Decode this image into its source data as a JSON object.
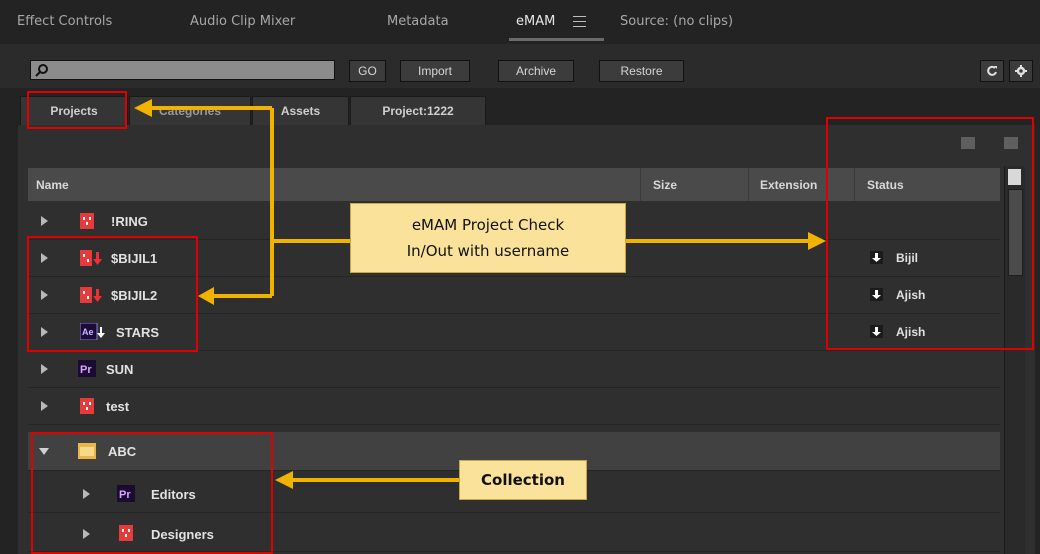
{
  "panel_tabs": [
    {
      "label": "Effect Controls",
      "active": false
    },
    {
      "label": "Audio Clip Mixer",
      "active": false
    },
    {
      "label": "Metadata",
      "active": false
    },
    {
      "label": "eMAM",
      "active": true
    },
    {
      "label": "Source: (no clips)",
      "active": false
    }
  ],
  "toolbar": {
    "search_value": "",
    "go_label": "GO",
    "import_label": "Import",
    "archive_label": "Archive",
    "restore_label": "Restore",
    "refresh_icon": "refresh-icon",
    "settings_icon": "gear-icon"
  },
  "sub_tabs": [
    "Projects",
    "Categories",
    "Assets",
    "Project:1222"
  ],
  "table": {
    "columns": [
      "Name",
      "Size",
      "Extension",
      "Status"
    ],
    "rows": [
      {
        "name": "!RING",
        "icon": "project-icon",
        "status": "",
        "expanded": false
      },
      {
        "name": "$BIJIL1",
        "icon": "project-checkout-icon",
        "status": "Bijil",
        "expanded": false
      },
      {
        "name": "$BIJIL2",
        "icon": "project-checkout-icon",
        "status": "Ajish",
        "expanded": false
      },
      {
        "name": "STARS",
        "icon": "after-effects-checkout-icon",
        "status": "Ajish",
        "expanded": false
      },
      {
        "name": "SUN",
        "icon": "premiere-icon",
        "status": "",
        "expanded": false
      },
      {
        "name": "test",
        "icon": "project-icon",
        "status": "",
        "expanded": false
      },
      {
        "name": "ABC",
        "icon": "collection-folder-icon",
        "status": "",
        "expanded": true
      },
      {
        "name": "Editors",
        "icon": "premiere-icon",
        "status": "",
        "child": true
      },
      {
        "name": "Designers",
        "icon": "project-icon",
        "status": "",
        "child": true
      }
    ]
  },
  "annotations": {
    "checkinout": "eMAM Project Check In/Out with username",
    "checkinout_line1": "eMAM Project Check",
    "checkinout_line2": "In/Out with username",
    "collection": "Collection"
  },
  "colors": {
    "accent": "#f0b400",
    "highlight_box": "#e00000",
    "callout_bg": "#fbe29a"
  }
}
